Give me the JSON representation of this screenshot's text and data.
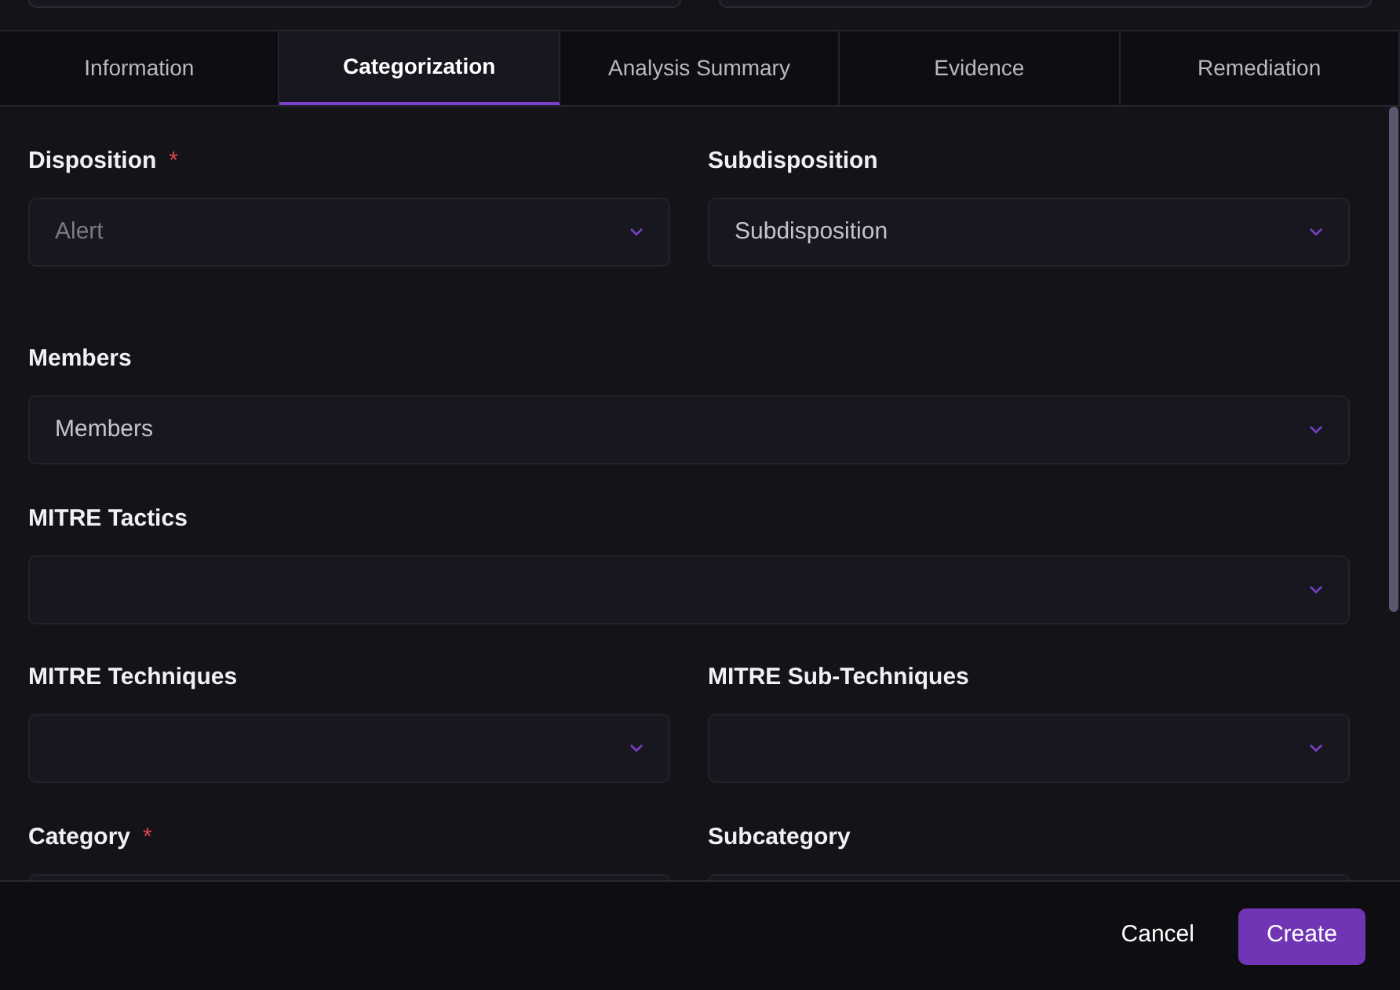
{
  "tabs": [
    {
      "label": "Information",
      "selected": false
    },
    {
      "label": "Categorization",
      "selected": true
    },
    {
      "label": "Analysis Summary",
      "selected": false
    },
    {
      "label": "Evidence",
      "selected": false
    },
    {
      "label": "Remediation",
      "selected": false
    }
  ],
  "form_rows": [
    [
      {
        "label": "Disposition",
        "required_mark": "*",
        "value": "Alert",
        "disabled": true
      },
      {
        "label": "Subdisposition",
        "placeholder": "Subdisposition",
        "disabled": false
      }
    ],
    [
      {
        "label": "Members",
        "placeholder": "Members"
      }
    ],
    [
      {
        "label": "MITRE Tactics"
      }
    ],
    [
      {
        "label": "MITRE Techniques"
      },
      {
        "label": "MITRE Sub-Techniques"
      }
    ],
    [
      {
        "label": "Category",
        "required_mark": "*"
      },
      {
        "label": "Subcategory"
      }
    ]
  ],
  "footer": {
    "cancel": "Cancel",
    "create": "Create"
  }
}
